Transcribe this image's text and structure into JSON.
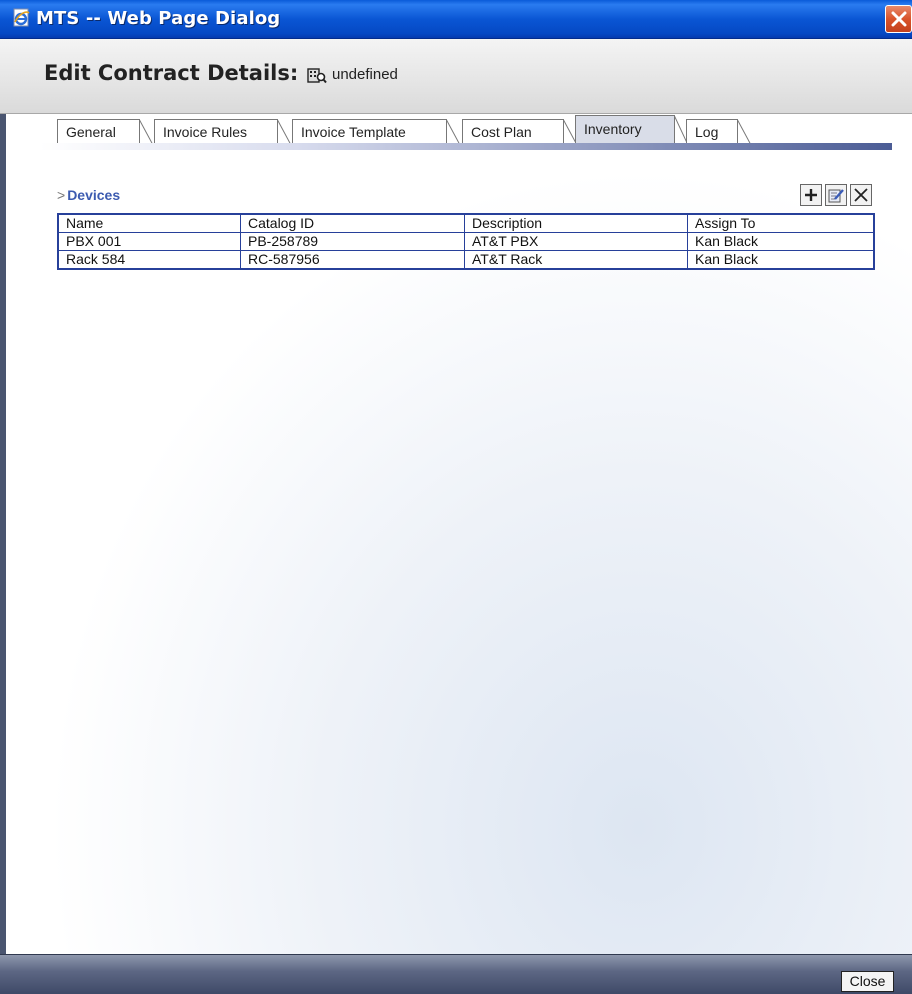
{
  "window": {
    "title": "MTS -- Web Page Dialog"
  },
  "header": {
    "title": "Edit Contract Details:",
    "subtitle": "undefined"
  },
  "tabs": [
    {
      "label": "General"
    },
    {
      "label": "Invoice Rules"
    },
    {
      "label": "Invoice Template"
    },
    {
      "label": "Cost Plan"
    },
    {
      "label": "Inventory",
      "active": true
    },
    {
      "label": "Log"
    }
  ],
  "devices": {
    "title": "Devices",
    "columns": [
      "Name",
      "Catalog ID",
      "Description",
      "Assign To"
    ],
    "rows": [
      [
        "PBX 001",
        "PB-258789",
        "AT&T PBX",
        "Kan Black"
      ],
      [
        "Rack 584",
        "RC-587956",
        "AT&T Rack",
        "Kan Black"
      ]
    ],
    "toolbar": [
      "add-icon",
      "edit-icon",
      "delete-icon"
    ]
  },
  "footer": {
    "close_label": "Close"
  }
}
